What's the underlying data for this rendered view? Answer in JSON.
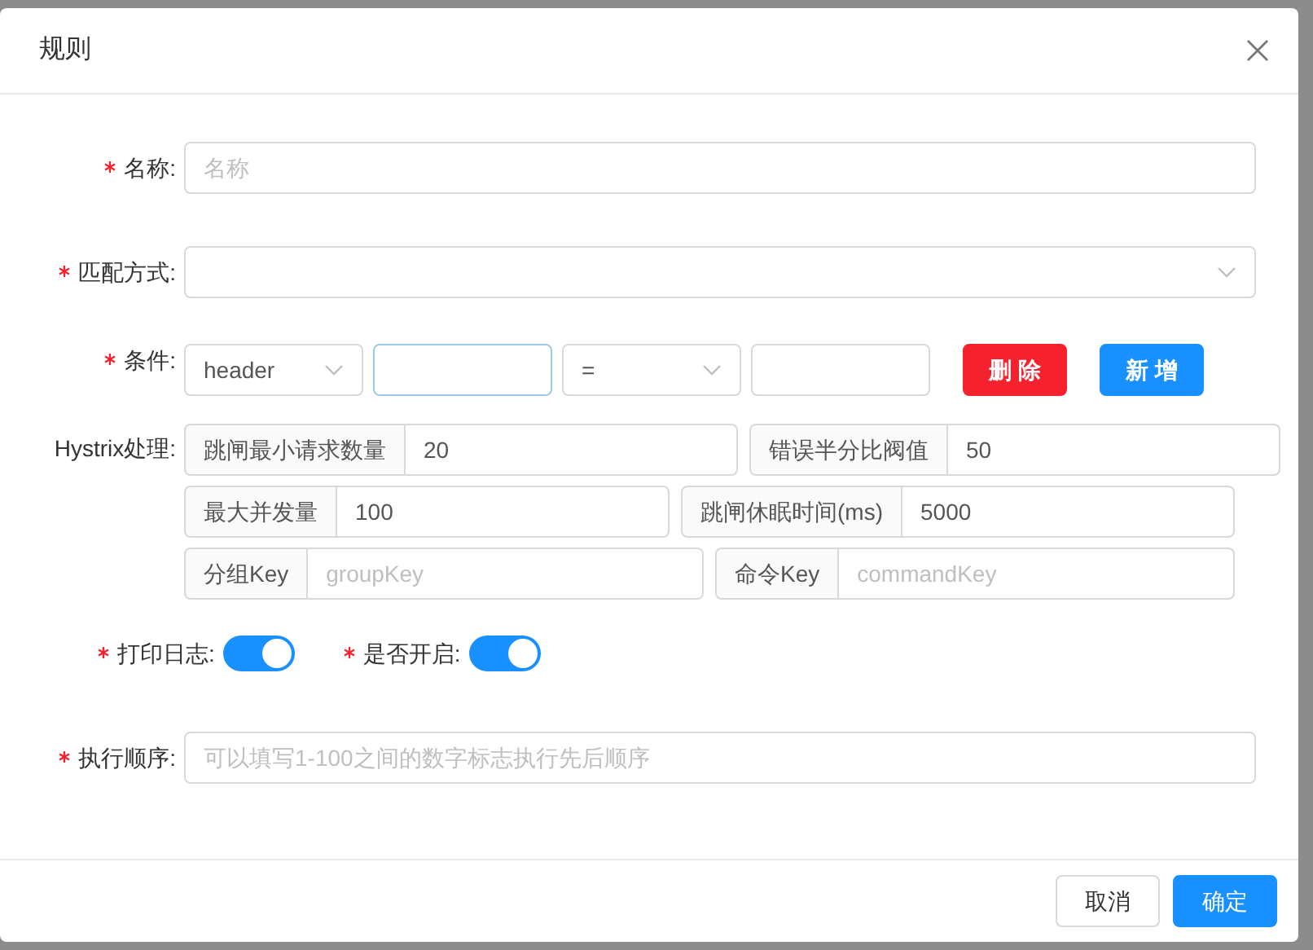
{
  "dialog": {
    "title": "规则"
  },
  "name_field": {
    "label": "名称:",
    "required": true,
    "placeholder": "名称"
  },
  "match_field": {
    "label": "匹配方式:",
    "required": true
  },
  "condition": {
    "label": "条件:",
    "required": true,
    "type_select": "header",
    "operator_select": "=",
    "key_focused": true,
    "buttons": [
      {
        "label": "删 除",
        "kind": "danger"
      },
      {
        "label": "新 增",
        "kind": "primary"
      }
    ]
  },
  "hystrix": {
    "label": "Hystrix处理:",
    "required": false,
    "rows": [
      [
        {
          "addon": "跳闸最小请求数量",
          "value": "20"
        },
        {
          "addon": "错误半分比阀值",
          "value": "50"
        }
      ],
      [
        {
          "addon": "最大并发量",
          "value": "100"
        },
        {
          "addon": "跳闸休眠时间(ms)",
          "value": "5000"
        }
      ],
      [
        {
          "addon": "分组Key",
          "placeholder": "groupKey"
        },
        {
          "addon": "命令Key",
          "placeholder": "commandKey"
        }
      ]
    ]
  },
  "switches": [
    {
      "label": "打印日志:",
      "required": true,
      "on": true
    },
    {
      "label": "是否开启:",
      "required": true,
      "on": true
    }
  ],
  "order_field": {
    "label": "执行顺序:",
    "required": true,
    "placeholder": "可以填写1-100之间的数字标志执行先后顺序"
  },
  "footer_buttons": [
    {
      "label": "取消",
      "kind": "default"
    },
    {
      "label": "确定",
      "kind": "primary"
    }
  ]
}
